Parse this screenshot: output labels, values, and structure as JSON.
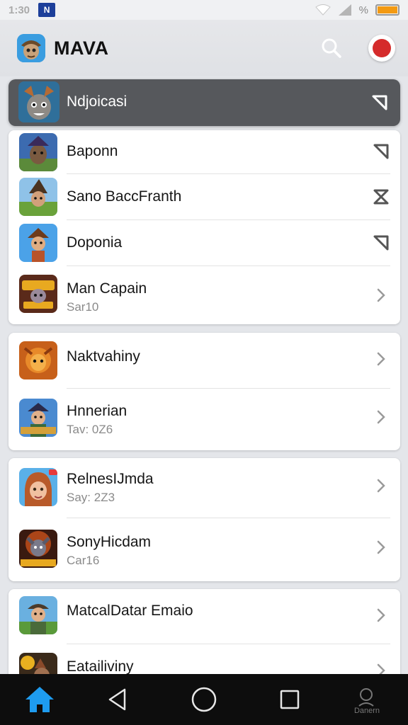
{
  "status_bar": {
    "time": "1:30",
    "badge": "N",
    "battery_pct_label": "%",
    "battery_level": 1.0
  },
  "header": {
    "title": "MAVA"
  },
  "list": [
    {
      "title": "Ndjoicasi",
      "subtitle": "",
      "trail": "share-arrow-icon",
      "highlighted": true
    },
    {
      "title": "Baponn",
      "subtitle": "",
      "trail": "share-arrow-icon"
    },
    {
      "title": "Sano BaccFranth",
      "subtitle": "",
      "trail": "close-x-icon"
    },
    {
      "title": "Doponia",
      "subtitle": "",
      "trail": "share-arrow-icon"
    },
    {
      "title": "Man Capain",
      "subtitle": "Sar10",
      "trail": "chevron-right-icon"
    },
    {
      "title": "Naktvahiny",
      "subtitle": "",
      "trail": "chevron-right-icon"
    },
    {
      "title": "Hnnerian",
      "subtitle": "Tav: 0Z6",
      "trail": "chevron-right-icon"
    },
    {
      "title": "RelnesIJmda",
      "subtitle": "Say: 2Z3",
      "trail": "chevron-right-icon"
    },
    {
      "title": "SonyHicdam",
      "subtitle": "Car16",
      "trail": "chevron-right-icon"
    },
    {
      "title": "MatcalDatar Emaio",
      "subtitle": "",
      "trail": "chevron-right-icon"
    },
    {
      "title": "Eatailiviny",
      "subtitle": "",
      "trail": "chevron-right-icon"
    }
  ],
  "nav": {
    "home_icon": "home-icon",
    "back_icon": "back-triangle-icon",
    "home_circle_icon": "circle-home-icon",
    "recents_icon": "square-recents-icon",
    "account_label": "Danern"
  },
  "colors": {
    "accent_blue": "#1e9cf0",
    "highlight_bg": "#56585c",
    "record_red": "#d52b2b",
    "battery_orange": "#f39a12"
  }
}
